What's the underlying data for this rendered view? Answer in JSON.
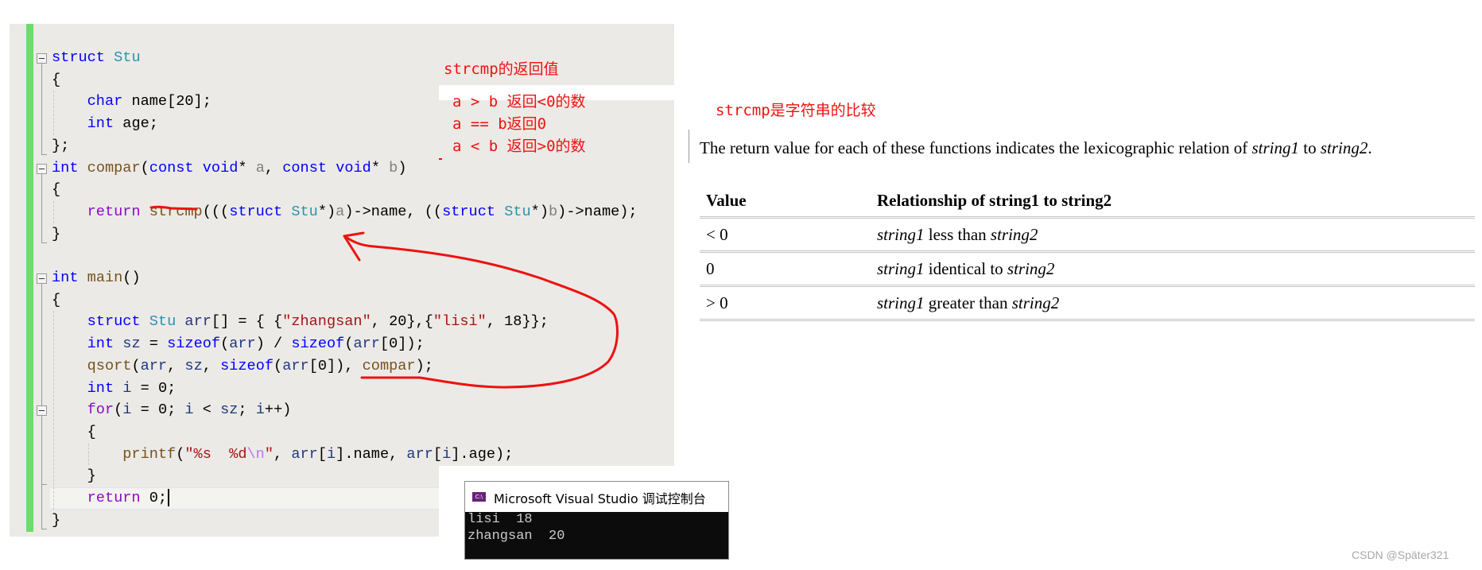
{
  "editor": {
    "lines": [
      [
        {
          "t": "struct",
          "c": "kw"
        },
        {
          "t": " "
        },
        {
          "t": "Stu",
          "c": "ty"
        }
      ],
      [
        {
          "t": "{"
        }
      ],
      [
        {
          "t": "    "
        },
        {
          "t": "char",
          "c": "kw"
        },
        {
          "t": " name[20];"
        }
      ],
      [
        {
          "t": "    "
        },
        {
          "t": "int",
          "c": "kw"
        },
        {
          "t": " age;"
        }
      ],
      [
        {
          "t": "};"
        }
      ],
      [
        {
          "t": "int",
          "c": "kw"
        },
        {
          "t": " "
        },
        {
          "t": "compar",
          "c": "fn"
        },
        {
          "t": "("
        },
        {
          "t": "const",
          "c": "kw"
        },
        {
          "t": " "
        },
        {
          "t": "void",
          "c": "kw"
        },
        {
          "t": "* "
        },
        {
          "t": "a",
          "c": "prm"
        },
        {
          "t": ", "
        },
        {
          "t": "const",
          "c": "kw"
        },
        {
          "t": " "
        },
        {
          "t": "void",
          "c": "kw"
        },
        {
          "t": "* "
        },
        {
          "t": "b",
          "c": "prm"
        },
        {
          "t": ")"
        }
      ],
      [
        {
          "t": "{"
        }
      ],
      [
        {
          "t": "    "
        },
        {
          "t": "return",
          "c": "ctl"
        },
        {
          "t": " "
        },
        {
          "t": "strcmp",
          "c": "fn"
        },
        {
          "t": "((("
        },
        {
          "t": "struct",
          "c": "kw"
        },
        {
          "t": " "
        },
        {
          "t": "Stu",
          "c": "ty"
        },
        {
          "t": "*)"
        },
        {
          "t": "a",
          "c": "prm"
        },
        {
          "t": ")->name, (("
        },
        {
          "t": "struct",
          "c": "kw"
        },
        {
          "t": " "
        },
        {
          "t": "Stu",
          "c": "ty"
        },
        {
          "t": "*)"
        },
        {
          "t": "b",
          "c": "prm"
        },
        {
          "t": ")->name);"
        }
      ],
      [
        {
          "t": "}"
        }
      ],
      [
        {
          "t": ""
        }
      ],
      [
        {
          "t": "int",
          "c": "kw"
        },
        {
          "t": " "
        },
        {
          "t": "main",
          "c": "fn"
        },
        {
          "t": "()"
        }
      ],
      [
        {
          "t": "{"
        }
      ],
      [
        {
          "t": "    "
        },
        {
          "t": "struct",
          "c": "kw"
        },
        {
          "t": " "
        },
        {
          "t": "Stu",
          "c": "ty"
        },
        {
          "t": " "
        },
        {
          "t": "arr",
          "c": "loc"
        },
        {
          "t": "[] = { {"
        },
        {
          "t": "\"zhangsan\"",
          "c": "str"
        },
        {
          "t": ", 20},{"
        },
        {
          "t": "\"lisi\"",
          "c": "str"
        },
        {
          "t": ", 18}};"
        }
      ],
      [
        {
          "t": "    "
        },
        {
          "t": "int",
          "c": "kw"
        },
        {
          "t": " "
        },
        {
          "t": "sz",
          "c": "loc"
        },
        {
          "t": " = "
        },
        {
          "t": "sizeof",
          "c": "kw"
        },
        {
          "t": "("
        },
        {
          "t": "arr",
          "c": "loc"
        },
        {
          "t": ") / "
        },
        {
          "t": "sizeof",
          "c": "kw"
        },
        {
          "t": "("
        },
        {
          "t": "arr",
          "c": "loc"
        },
        {
          "t": "[0]);"
        }
      ],
      [
        {
          "t": "    "
        },
        {
          "t": "qsort",
          "c": "fn"
        },
        {
          "t": "("
        },
        {
          "t": "arr",
          "c": "loc"
        },
        {
          "t": ", "
        },
        {
          "t": "sz",
          "c": "loc"
        },
        {
          "t": ", "
        },
        {
          "t": "sizeof",
          "c": "kw"
        },
        {
          "t": "("
        },
        {
          "t": "arr",
          "c": "loc"
        },
        {
          "t": "[0]), "
        },
        {
          "t": "compar",
          "c": "fn"
        },
        {
          "t": ");"
        }
      ],
      [
        {
          "t": "    "
        },
        {
          "t": "int",
          "c": "kw"
        },
        {
          "t": " "
        },
        {
          "t": "i",
          "c": "loc"
        },
        {
          "t": " = 0;"
        }
      ],
      [
        {
          "t": "    "
        },
        {
          "t": "for",
          "c": "ctl"
        },
        {
          "t": "("
        },
        {
          "t": "i",
          "c": "loc"
        },
        {
          "t": " = 0; "
        },
        {
          "t": "i",
          "c": "loc"
        },
        {
          "t": " < "
        },
        {
          "t": "sz",
          "c": "loc"
        },
        {
          "t": "; "
        },
        {
          "t": "i",
          "c": "loc"
        },
        {
          "t": "++)"
        }
      ],
      [
        {
          "t": "    {"
        }
      ],
      [
        {
          "t": "        "
        },
        {
          "t": "printf",
          "c": "fn"
        },
        {
          "t": "("
        },
        {
          "t": "\"%s  %d",
          "c": "str"
        },
        {
          "t": "\\n",
          "c": "esc"
        },
        {
          "t": "\"",
          "c": "str"
        },
        {
          "t": ", "
        },
        {
          "t": "arr",
          "c": "loc"
        },
        {
          "t": "["
        },
        {
          "t": "i",
          "c": "loc"
        },
        {
          "t": "].name, "
        },
        {
          "t": "arr",
          "c": "loc"
        },
        {
          "t": "["
        },
        {
          "t": "i",
          "c": "loc"
        },
        {
          "t": "].age);"
        }
      ],
      [
        {
          "t": "    }"
        }
      ],
      [
        {
          "t": "    "
        },
        {
          "t": "return",
          "c": "ctl"
        },
        {
          "t": " 0;"
        }
      ],
      [
        {
          "t": "}"
        }
      ]
    ],
    "current_line": 20,
    "fold_lines": [
      0,
      5,
      10,
      16
    ]
  },
  "annotation": {
    "title": "strcmp的返回值",
    "rules": [
      "a > b 返回<0的数",
      "a == b返回0",
      "a < b 返回>0的数"
    ],
    "side_note": "strcmp是字符串的比较",
    "color": "#ee1111"
  },
  "console": {
    "title": "Microsoft Visual Studio 调试控制台",
    "icon_label": "C:\\",
    "output": [
      "lisi  18",
      "zhangsan  20"
    ]
  },
  "docs": {
    "para_pre": "The return value for each of these functions indicates the lexicographic relation of ",
    "para_s1": "string1",
    "para_mid": " to ",
    "para_s2": "string2",
    "para_end": ".",
    "table": {
      "headers": [
        "Value",
        "Relationship of string1 to string2"
      ],
      "rows": [
        {
          "value": "< 0",
          "s1": "string1",
          "rel": " less than ",
          "s2": "string2"
        },
        {
          "value": "0",
          "s1": "string1",
          "rel": " identical to ",
          "s2": "string2"
        },
        {
          "value": "> 0",
          "s1": "string1",
          "rel": " greater than ",
          "s2": "string2"
        }
      ]
    }
  },
  "watermark": "CSDN @Später321"
}
